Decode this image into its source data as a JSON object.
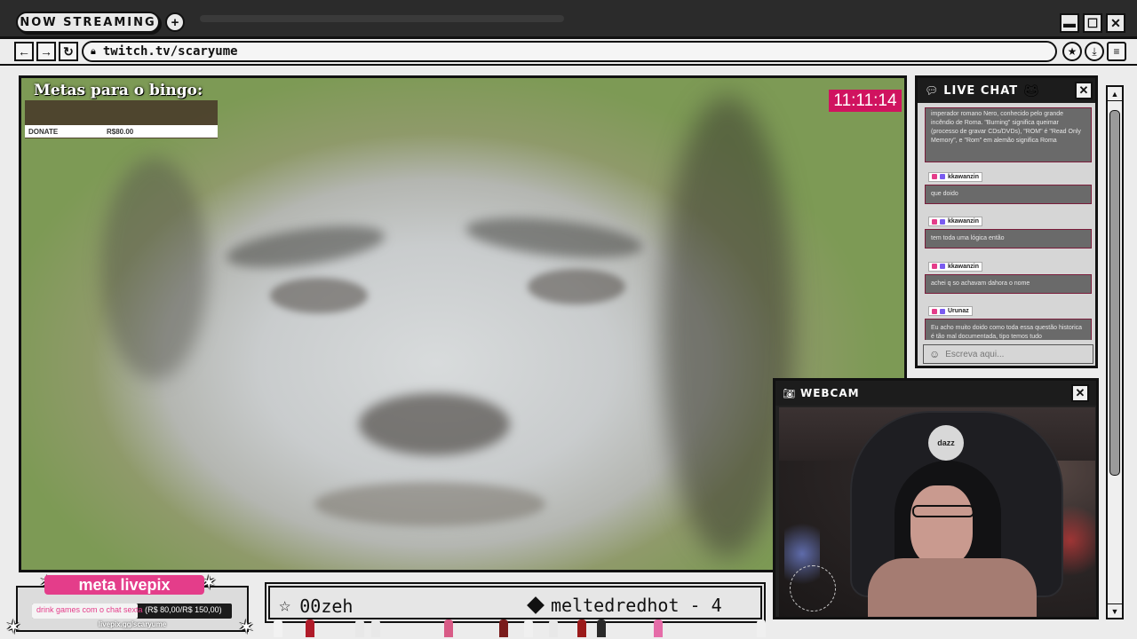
{
  "window": {
    "title": "NOW STREAMING",
    "controls": [
      "minimize",
      "maximize",
      "close"
    ]
  },
  "navbar": {
    "url": "twitch.tv/scaryume"
  },
  "stream": {
    "bingo_title": "Metas para o bingo:",
    "bingo_row": {
      "label": "DONATE",
      "value": "R$80.00"
    },
    "clock": "11:11:14"
  },
  "chat": {
    "title": "LIVE CHAT",
    "first_message": "imperador romano Nero, conhecido pelo grande incêndio de Roma. \"Burning\" significa queimar (processo de gravar CDs/DVDs), \"ROM\" é \"Read Only Memory\", e \"Rom\" em alemão significa Roma",
    "messages": [
      {
        "user": "kkawanzin",
        "text": "que doido"
      },
      {
        "user": "kkawanzin",
        "text": "tem toda uma lógica então"
      },
      {
        "user": "kkawanzin",
        "text": "achei q so achavam dahora o nome"
      },
      {
        "user": "Urunaz",
        "text": "Eu acho muito doido como toda essa questão historica é tão mal documentada, tipo temos tudo aproximadamente, é muito doido"
      }
    ],
    "input_placeholder": "Escreva aqui..."
  },
  "webcam": {
    "title": "WEBCAM",
    "chair_logo": "dazz"
  },
  "livepix": {
    "title": "meta livepix",
    "goal_text": "drink games com o chat sexta",
    "amount": "(R$ 80,00/R$ 150,00)",
    "progress_percent": 53,
    "url": "livepix.gg/scaryume"
  },
  "ticker": {
    "items": [
      "00zeh",
      "meltedredhot - 4"
    ]
  },
  "colors": {
    "accent_pink": "#e43d8a",
    "clock_bg": "#d0135f",
    "chrome_dark": "#2b2b2b"
  }
}
